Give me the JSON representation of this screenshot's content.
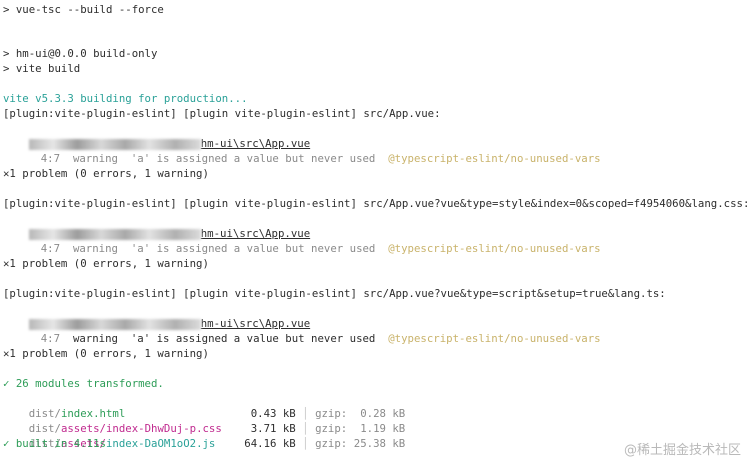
{
  "lines": {
    "l1": "> vue-tsc --build --force",
    "l2": "> hm-ui@0.0.0 build-only",
    "l3": "> vite build",
    "l4": "vite v5.3.3 building for production...",
    "l5": "[plugin:vite-plugin-eslint] [plugin vite-plugin-eslint] src/App.vue:",
    "l6_tail": "hm-ui\\src\\App.vue",
    "l7": {
      "pos": "4:7",
      "level": "warning",
      "msg": "'a' is assigned a value but never used",
      "rule": "@typescript-eslint/no-unused-vars"
    },
    "l8": "✕1 problem (0 errors, 1 warning)",
    "l9": "[plugin:vite-plugin-eslint] [plugin vite-plugin-eslint] src/App.vue?vue&type=style&index=0&scoped=f4954060&lang.css:",
    "l10_tail": "hm-ui\\src\\App.vue",
    "l11": {
      "pos": "4:7",
      "level": "warning",
      "msg": "'a' is assigned a value but never used",
      "rule": "@typescript-eslint/no-unused-vars"
    },
    "l12": "✕1 problem (0 errors, 1 warning)",
    "l13": "[plugin:vite-plugin-eslint] [plugin vite-plugin-eslint] src/App.vue?vue&type=script&setup=true&lang.ts:",
    "l14_tail": "hm-ui\\src\\App.vue",
    "l15": {
      "pos": "4:7",
      "level": "warning",
      "msg": "'a' is assigned a value but never used",
      "rule": "@typescript-eslint/no-unused-vars"
    },
    "l16": "✕1 problem (0 errors, 1 warning)",
    "l17": "✓ 26 modules transformed.",
    "built": "✓ built in 4.11s"
  },
  "files": [
    {
      "dir": "dist/",
      "sub": "",
      "name": "index.html",
      "size": "0.43 kB",
      "gzip_label": "gzip:",
      "gzip": "0.28 kB",
      "color": "green"
    },
    {
      "dir": "dist/",
      "sub": "assets/",
      "name": "index-DhwDuj-p.css",
      "size": "3.71 kB",
      "gzip_label": "gzip:",
      "gzip": "1.19 kB",
      "color": "magenta"
    },
    {
      "dir": "dist/",
      "sub": "assets/",
      "name": "index-DaOM1oO2.js",
      "size": "64.16 kB",
      "gzip_label": "gzip:",
      "gzip": "25.38 kB",
      "color": "cyan"
    }
  ],
  "separator": "│",
  "watermark": "@稀土掘金技术社区"
}
